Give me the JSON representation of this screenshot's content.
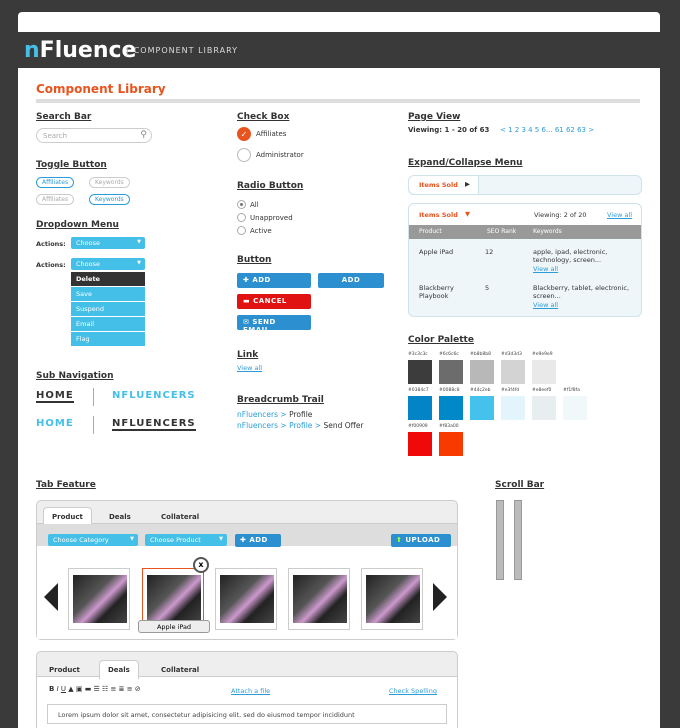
{
  "brand": {
    "logo_n": "n",
    "logo_rest": "Fluence",
    "subtitle": "COMPONENT LIBRARY"
  },
  "page_title": "Component Library",
  "sections": {
    "search": "Search Bar",
    "toggle": "Toggle Button",
    "dropdown": "Dropdown Menu",
    "subnav": "Sub Navigation",
    "checkbox": "Check Box",
    "radio": "Radio Button",
    "button": "Button",
    "link": "Link",
    "breadcrumb": "Breadcrumb Trail",
    "pageview": "Page View",
    "expand": "Expand/Collapse Menu",
    "palette": "Color Palette",
    "tab": "Tab Feature",
    "scroll": "Scroll Bar"
  },
  "search": {
    "placeholder": "Search",
    "icon": "search-icon"
  },
  "toggles": [
    [
      "Affiliates",
      "Keywords"
    ],
    [
      "Affiliates",
      "Keywords"
    ]
  ],
  "dropdown": {
    "label": "Actions:",
    "value": "Choose",
    "items": [
      "Delete",
      "Save",
      "Suspend",
      "Email",
      "Flag"
    ]
  },
  "subnav": [
    [
      "HOME",
      "NFLUENCERS"
    ],
    [
      "HOME",
      "NFLUENCERS"
    ]
  ],
  "checkbox": [
    "Affiliates",
    "Administrator"
  ],
  "radio": [
    "All",
    "Unapproved",
    "Active"
  ],
  "buttons": {
    "add": "ADD",
    "add2": "ADD",
    "cancel": "CANCEL",
    "email": "SEND EMAIL"
  },
  "link": "View all",
  "breadcrumbs": [
    {
      "a": "nFluencers",
      "b": "Profile",
      "c": ""
    },
    {
      "a": "nFluencers",
      "b": "Profile",
      "c": "Send Offer"
    }
  ],
  "pageview": {
    "text": "Viewing: 1 - 20 of 63",
    "nums": "< 1 2 3 4 5 6... 61 62 63 >"
  },
  "expand": {
    "label": "Items Sold",
    "viewing": "Viewing: 2 of 20",
    "viewall": "View all",
    "headers": [
      "Product",
      "SEO Rank",
      "Keywords"
    ],
    "rows": [
      [
        "Apple iPad",
        "12",
        "apple, ipad, electronic, technology, screen..."
      ],
      [
        "Blackberry Playbook",
        "5",
        "Blackberry, tablet, electronic, screen..."
      ]
    ]
  },
  "palette": [
    {
      "hex": "#3c3c3c",
      "label": "#3c3c3c"
    },
    {
      "hex": "#6c6c6c",
      "label": "#6c6c6c"
    },
    {
      "hex": "#b8b8b8",
      "label": "#b8b8b8"
    },
    {
      "hex": "#d3d3d3",
      "label": "#d3d3d3"
    },
    {
      "hex": "#e9e9e9",
      "label": "#e9e9e9"
    },
    {
      "hex": "#0384c7",
      "label": "#0384c7"
    },
    {
      "hex": "#0088c8",
      "label": "#0088c8"
    },
    {
      "hex": "#44c2eb",
      "label": "#44c2eb"
    },
    {
      "hex": "#e3f4fd",
      "label": "#e3f4fd"
    },
    {
      "hex": "#e8eef0",
      "label": "#e8eef0"
    },
    {
      "hex": "#f1f8fa",
      "label": "#f1f8fa"
    },
    {
      "hex": "#f00909",
      "label": "#f00909"
    },
    {
      "hex": "#f83a00",
      "label": "#f83a00"
    }
  ],
  "tabs1": {
    "tabs": [
      "Product",
      "Deals",
      "Collateral"
    ],
    "cat": "Choose Category",
    "prod": "Choose Product",
    "add": "ADD",
    "upload": "UPLOAD",
    "caption": "Apple iPad"
  },
  "tabs2": {
    "tabs": [
      "Product",
      "Deals",
      "Collateral"
    ],
    "attach": "Attach a file",
    "spell": "Check Spelling",
    "body": "Lorem ipsum dolor sit amet, consectetur adipisicing elit, sed do eiusmod tempor incididunt"
  },
  "colors": {
    "accent": "#e8541f",
    "blue": "#2c9cd8"
  }
}
